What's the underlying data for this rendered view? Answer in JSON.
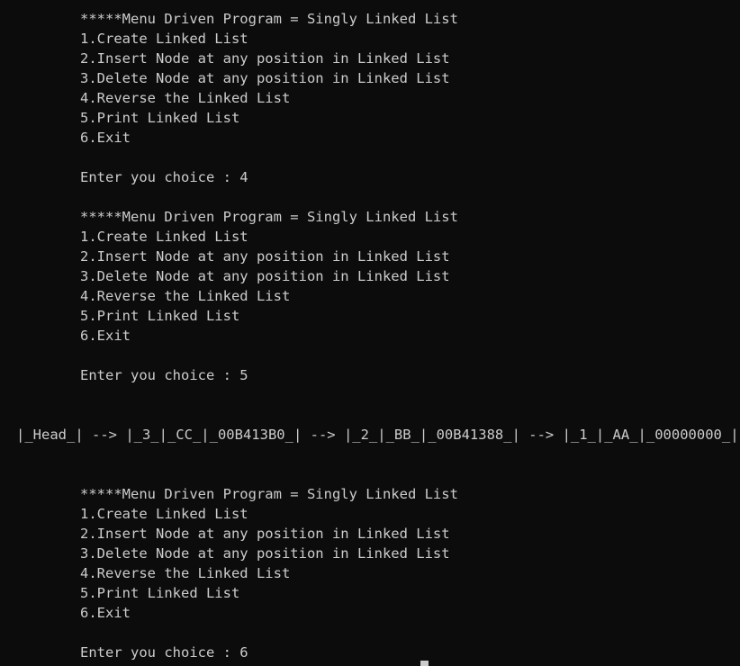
{
  "terminal": {
    "lines": [
      "*****Menu Driven Program = Singly Linked List",
      "1.Create Linked List",
      "2.Insert Node at any position in Linked List",
      "3.Delete Node at any position in Linked List",
      "4.Reverse the Linked List",
      "5.Print Linked List",
      "6.Exit",
      "",
      "Enter you choice : 4",
      "",
      "*****Menu Driven Program = Singly Linked List",
      "1.Create Linked List",
      "2.Insert Node at any position in Linked List",
      "3.Delete Node at any position in Linked List",
      "4.Reverse the Linked List",
      "5.Print Linked List",
      "6.Exit",
      "",
      "Enter you choice : 5",
      "",
      "",
      "|_Head_| --> |_3_|_CC_|_00B413B0_| --> |_2_|_BB_|_00B41388_| --> |_1_|_AA_|_00000000_|",
      "",
      "",
      "*****Menu Driven Program = Singly Linked List",
      "1.Create Linked List",
      "2.Insert Node at any position in Linked List",
      "3.Delete Node at any position in Linked List",
      "4.Reverse the Linked List",
      "5.Print Linked List",
      "6.Exit",
      "",
      "Enter you choice : 6"
    ]
  },
  "colors": {
    "background": "#0c0c0c",
    "text": "#cccccc"
  }
}
